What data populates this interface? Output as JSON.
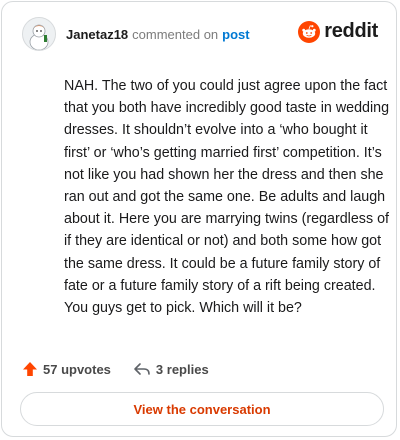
{
  "header": {
    "author": "Janetaz18",
    "commented_on": "commented on",
    "post_link": "post",
    "brand": "reddit",
    "icons": {
      "avatar": "user-avatar",
      "logo": "reddit-snoo-logo"
    }
  },
  "comment": {
    "text": "NAH. The two of you could just agree upon the fact that you both have incredibly good taste in wedding dresses. It shouldn’t evolve into a ‘who bought it first’ or ‘who’s getting married first’ competition. It’s not like you had shown her the dress and then she ran out and got the same one. Be adults and laugh about it. Here you are marrying twins (regardless of if they are identical or not) and both some how got the same dress. It could be a future family story of fate or a future family story of a rift being created. You guys get to pick. Which will it be?"
  },
  "stats": {
    "upvotes": "57 upvotes",
    "replies": "3 replies",
    "icons": {
      "upvote": "upvote-arrow-icon",
      "reply": "reply-arrow-icon"
    }
  },
  "actions": {
    "view_conversation": "View the conversation"
  },
  "colors": {
    "brand_orange": "#ff4500",
    "link_blue": "#0079d3",
    "button_text": "#d93a00",
    "border": "#d7dadc"
  }
}
